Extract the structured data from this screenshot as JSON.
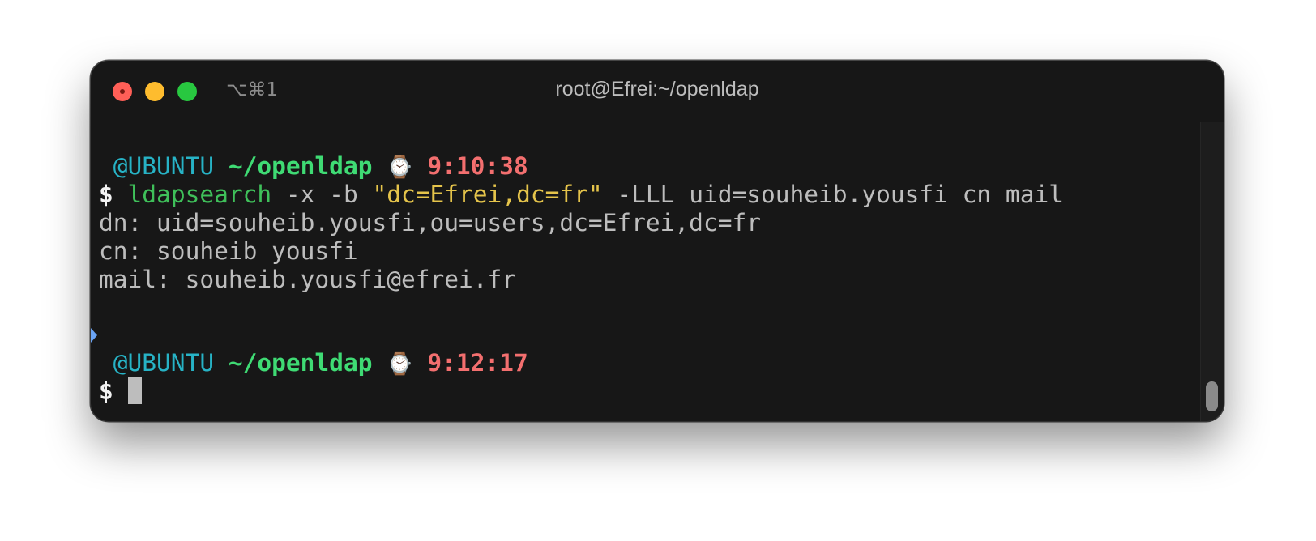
{
  "window": {
    "shortcut": "⌥⌘1",
    "title": "root@Efrei:~/openldap"
  },
  "prompt1": {
    "host": "@UBUNTU",
    "path": "~/openldap",
    "icon": "watch-icon",
    "time": "9:10:38"
  },
  "command": {
    "symbol": "$",
    "program": "ldapsearch",
    "arg1": " -x -b ",
    "quoted": "\"dc=Efrei,dc=fr\"",
    "rest": " -LLL uid=souheib.yousfi cn mail"
  },
  "output": [
    "dn: uid=souheib.yousfi,ou=users,dc=Efrei,dc=fr",
    "cn: souheib yousfi",
    "mail: souheib.yousfi@efrei.fr"
  ],
  "prompt2": {
    "host": "@UBUNTU",
    "path": "~/openldap",
    "icon": "watch-icon",
    "time": "9:12:17"
  },
  "prompt_symbol": "$",
  "colors": {
    "host": "#27b3c6",
    "path": "#3fdb74",
    "time": "#f36f6f",
    "program": "#3fc05a",
    "string": "#e5c44b",
    "background": "#171717"
  }
}
